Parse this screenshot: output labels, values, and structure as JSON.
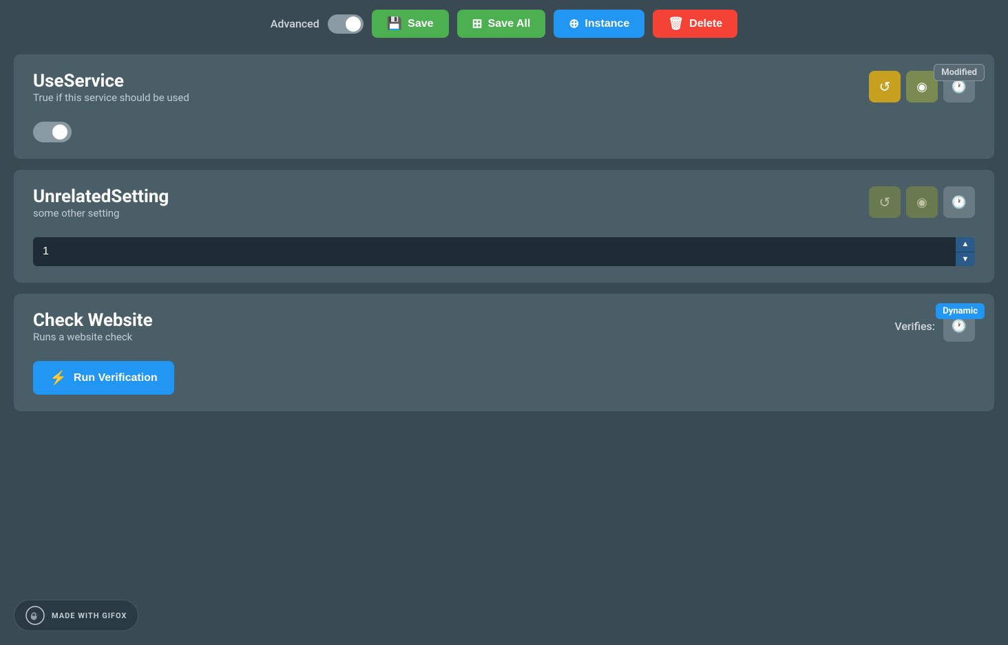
{
  "toolbar": {
    "advanced_label": "Advanced",
    "advanced_toggle_on": false,
    "save_label": "Save",
    "save_all_label": "Save All",
    "instance_label": "Instance",
    "delete_label": "Delete"
  },
  "cards": [
    {
      "id": "use-service",
      "title": "UseService",
      "description": "True if this service should be used",
      "badge": "Modified",
      "badge_type": "modified",
      "toggle_value": true,
      "has_toggle": true,
      "has_number_input": false,
      "has_verification": false,
      "action_buttons": [
        {
          "id": "refresh",
          "icon": "↺",
          "type": "yellow",
          "label": "Refresh"
        },
        {
          "id": "eye",
          "icon": "◉",
          "type": "olive",
          "label": "View"
        },
        {
          "id": "history",
          "icon": "⏱",
          "type": "gray",
          "label": "History"
        }
      ]
    },
    {
      "id": "unrelated-setting",
      "title": "UnrelatedSetting",
      "description": "some other setting",
      "badge": null,
      "badge_type": null,
      "has_toggle": false,
      "has_number_input": true,
      "number_value": "1",
      "has_verification": false,
      "action_buttons": [
        {
          "id": "refresh",
          "icon": "↺",
          "type": "olive-dim",
          "label": "Refresh"
        },
        {
          "id": "eye",
          "icon": "◉",
          "type": "olive-dim",
          "label": "View"
        },
        {
          "id": "history",
          "icon": "⏱",
          "type": "gray",
          "label": "History"
        }
      ]
    },
    {
      "id": "check-website",
      "title": "Check Website",
      "description": "Runs a website check",
      "badge": "Dynamic",
      "badge_type": "dynamic",
      "has_toggle": false,
      "has_number_input": false,
      "has_verification": true,
      "verifies_label": "Verifies:",
      "run_verification_label": "Run Verification",
      "action_buttons": []
    }
  ],
  "footer": {
    "made_with_label": "MADE WITH GIFOX"
  }
}
